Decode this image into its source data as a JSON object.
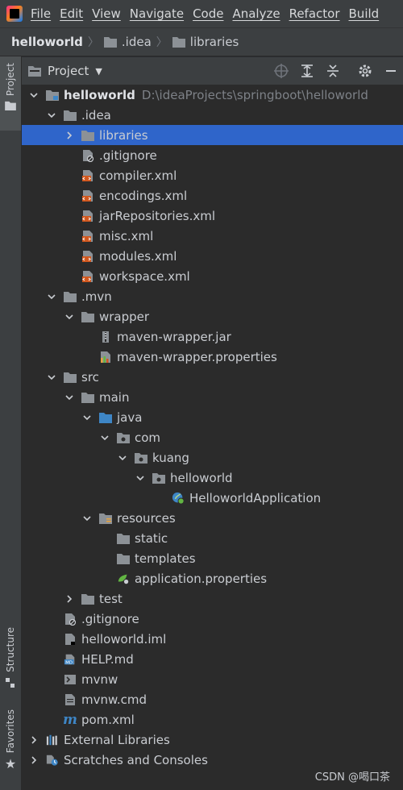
{
  "menubar": {
    "items": [
      "File",
      "Edit",
      "View",
      "Navigate",
      "Code",
      "Analyze",
      "Refactor",
      "Build"
    ]
  },
  "breadcrumb": {
    "items": [
      "helloworld",
      ".idea",
      "libraries"
    ]
  },
  "sidebar": {
    "project_tab": "Project",
    "structure_tab": "Structure",
    "favorites_tab": "Favorites"
  },
  "panel": {
    "title": "Project",
    "icons": [
      "target-icon",
      "expand-all-icon",
      "collapse-all-icon",
      "gear-icon",
      "minimize-icon"
    ]
  },
  "tree": {
    "root_label": "helloworld",
    "root_path": "D:\\ideaProjects\\springboot\\helloworld",
    "items": [
      ".idea",
      "libraries",
      ".gitignore",
      "compiler.xml",
      "encodings.xml",
      "jarRepositories.xml",
      "misc.xml",
      "modules.xml",
      "workspace.xml",
      ".mvn",
      "wrapper",
      "maven-wrapper.jar",
      "maven-wrapper.properties",
      "src",
      "main",
      "java",
      "com",
      "kuang",
      "helloworld",
      "HelloworldApplication",
      "resources",
      "static",
      "templates",
      "application.properties",
      "test",
      ".gitignore",
      "helloworld.iml",
      "HELP.md",
      "mvnw",
      "mvnw.cmd",
      "pom.xml",
      "External Libraries",
      "Scratches and Consoles"
    ]
  },
  "watermark": "CSDN @喝口茶",
  "colors": {
    "selection": "#2f65ca",
    "folder": "#8c9196",
    "xml": "#d2581f",
    "java_folder": "#3e86c6"
  }
}
